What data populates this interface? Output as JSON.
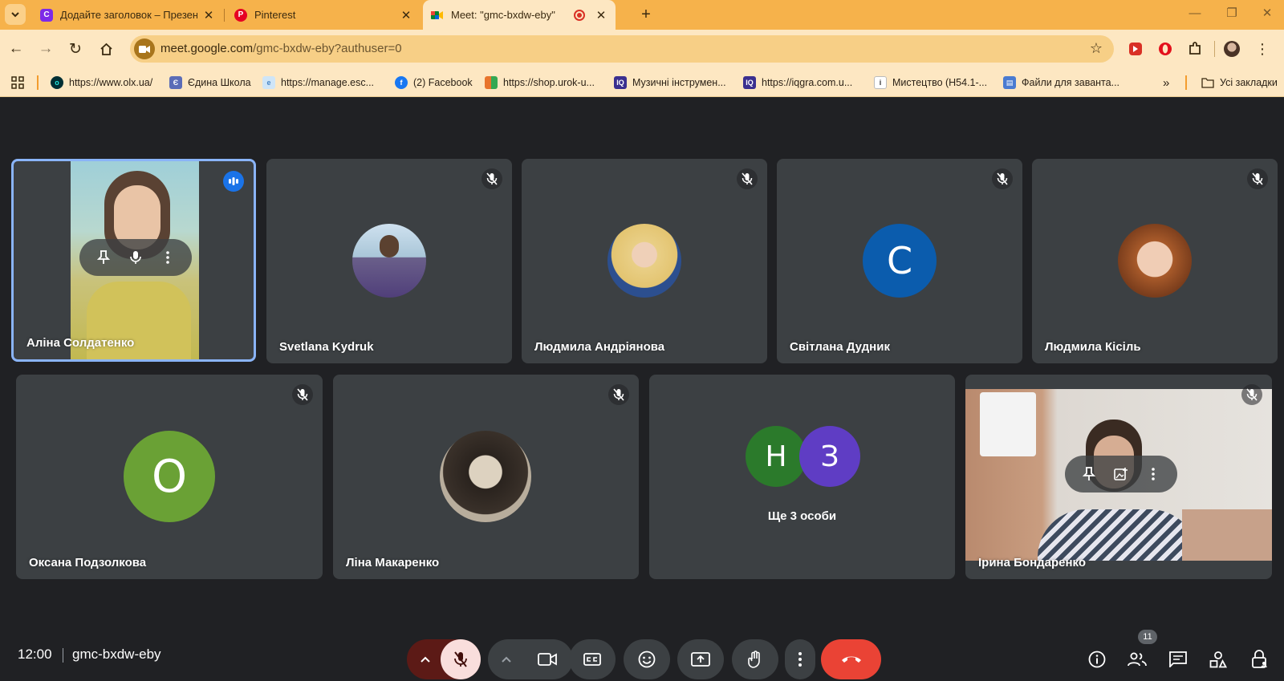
{
  "browser": {
    "tabs": [
      {
        "title": "Додайте заголовок – Презентація",
        "icon": "canva-icon"
      },
      {
        "title": "Pinterest",
        "icon": "pinterest-icon"
      },
      {
        "title": "Meet: \"gmc-bxdw-eby\"",
        "icon": "meet-icon",
        "recording": true
      }
    ],
    "url_host": "meet.google.com",
    "url_path": "/gmc-bxdw-eby?authuser=0",
    "bookmarks": [
      {
        "label": "https://www.olx.ua/",
        "color": "#23e5db"
      },
      {
        "label": "Єдина Школа",
        "color": "#5b6cb7"
      },
      {
        "label": "https://manage.esc...",
        "color": "#8fbde8"
      },
      {
        "label": "(2) Facebook",
        "color": "#1877f2"
      },
      {
        "label": "https://shop.urok-u...",
        "color": "#e8742c"
      },
      {
        "label": "Музичні інструмен...",
        "color": "#3b2f8f"
      },
      {
        "label": "https://iqgra.com.u...",
        "color": "#3b2f8f"
      },
      {
        "label": "Мистецтво (Н54.1-...",
        "color": "#ffffff"
      },
      {
        "label": "Файли для заванта...",
        "color": "#4a7bd1"
      }
    ],
    "bookmarks_more": "»",
    "all_bookmarks": "Усі закладки"
  },
  "meeting": {
    "participants": [
      {
        "name": "Аліна Солдатенко",
        "type": "video",
        "speaking": true
      },
      {
        "name": "Svetlana Kydruk",
        "type": "photo",
        "muted": true
      },
      {
        "name": "Людмила Андріянова",
        "type": "photo",
        "muted": true
      },
      {
        "name": "Світлана Дудник",
        "type": "letter",
        "letter": "С",
        "color": "#0b5cad",
        "muted": true
      },
      {
        "name": "Людмила Кісіль",
        "type": "photo",
        "muted": true
      },
      {
        "name": "Оксана Подзолкова",
        "type": "letter",
        "letter": "О",
        "color": "#6aa135",
        "muted": true
      },
      {
        "name": "Ліна Макаренко",
        "type": "photo",
        "muted": true
      },
      {
        "name": "Ірина Бондаренко",
        "type": "video",
        "muted": true
      }
    ],
    "others": {
      "label": "Ще 3 особи",
      "letters": [
        {
          "letter": "Н",
          "color": "#2b7a2b"
        },
        {
          "letter": "З",
          "color": "#5f3dc4"
        }
      ]
    }
  },
  "bottom_bar": {
    "time": "12:00",
    "meeting_code": "gmc-bxdw-eby",
    "people_count": "11",
    "end_call_color": "#ea4335"
  }
}
